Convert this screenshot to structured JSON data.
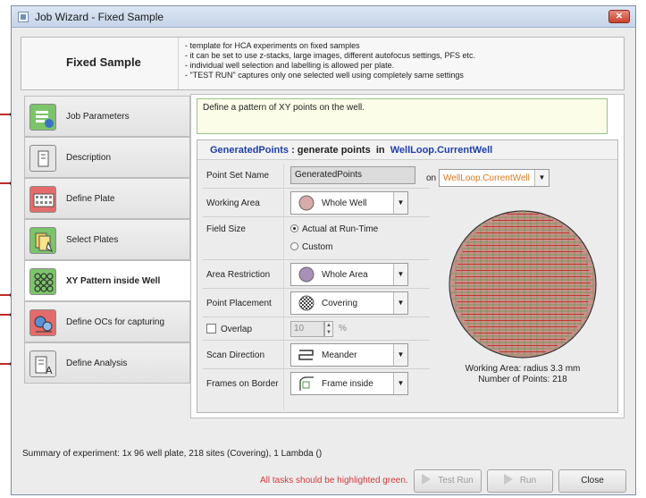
{
  "window": {
    "title": "Job Wizard - Fixed Sample",
    "close_glyph": "✕"
  },
  "header": {
    "title": "Fixed Sample",
    "notes": [
      "- template for HCA experiments on fixed samples",
      "- it can be set to use z-stacks, large images, different autofocus settings, PFS etc.",
      "- individual well selection and labelling is allowed per plate.",
      "- \"TEST RUN\" captures only one selected well using completely same settings"
    ]
  },
  "nav": {
    "items": [
      {
        "label": "Job Parameters",
        "icon": "job-parameters-icon",
        "color": "#7cc46b"
      },
      {
        "label": "Description",
        "icon": "description-icon",
        "color": "#e6e6e6"
      },
      {
        "label": "Define Plate",
        "icon": "plate-icon",
        "color": "#e46b6b"
      },
      {
        "label": "Select Plates",
        "icon": "select-plates-icon",
        "color": "#7cc46b"
      },
      {
        "label": "XY Pattern inside Well",
        "icon": "xy-pattern-icon",
        "color": "#7cc46b"
      },
      {
        "label": "Define OCs for capturing",
        "icon": "optical-config-icon",
        "color": "#e46b6b"
      },
      {
        "label": "Define Analysis",
        "icon": "analysis-icon",
        "color": "#e6e6e6"
      }
    ]
  },
  "content": {
    "description": "Define a pattern of XY points on the well.",
    "panel_header": {
      "name": "GeneratedPoints",
      "sep": " : generate points  in  ",
      "loop": "WellLoop.CurrentWell"
    },
    "fields": {
      "point_set_name_label": "Point Set Name",
      "point_set_name_value": "GeneratedPoints",
      "on_label": "on",
      "on_value": "WellLoop.CurrentWell",
      "working_area_label": "Working Area",
      "working_area_value": "Whole Well",
      "field_size_label": "Field Size",
      "field_size_opt1": "Actual at Run-Time",
      "field_size_opt2": "Custom",
      "area_restriction_label": "Area Restriction",
      "area_restriction_value": "Whole Area",
      "point_placement_label": "Point Placement",
      "point_placement_value": "Covering",
      "overlap_label": "Overlap",
      "overlap_value": "10",
      "overlap_unit": "%",
      "scan_direction_label": "Scan Direction",
      "scan_direction_value": "Meander",
      "frames_on_border_label": "Frames on Border",
      "frames_on_border_value": "Frame inside"
    },
    "preview": {
      "working_area": "Working Area: radius 3.3 mm",
      "num_points": "Number of Points: 218"
    }
  },
  "footer": {
    "summary": "Summary of experiment: 1x 96 well plate, 218 sites (Covering), 1 Lambda ()",
    "warning": "All tasks should be highlighted green.",
    "test_run_label": "Test Run",
    "run_label": "Run",
    "close_label": "Close"
  },
  "colors": {
    "accent_blue": "#1f3ea8",
    "loop_orange": "#e07a1c",
    "warning_red": "#d23a3a",
    "indicator_red": "#c22a2a",
    "well_fill": "#c9908f",
    "grid_green": "#6d9a52",
    "scan_line": "#c0392b"
  }
}
